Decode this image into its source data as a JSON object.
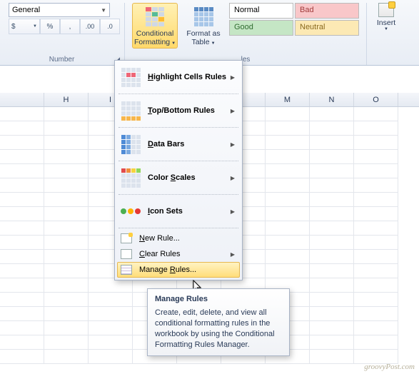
{
  "ribbon": {
    "number": {
      "format_value": "General",
      "group_label": "Number",
      "currency": "$",
      "percent": "%",
      "comma": ",",
      "inc_dec": "←0",
      "dec_dec": "0→"
    },
    "styles": {
      "cond_fmt_label": "Conditional Formatting",
      "fmt_table_label": "Format as Table",
      "normal": "Normal",
      "bad": "Bad",
      "good": "Good",
      "neutral": "Neutral",
      "group_label_fragment": "les"
    },
    "cells": {
      "insert_label": "Insert"
    }
  },
  "columns": [
    "",
    "H",
    "I",
    "",
    "",
    "",
    "M",
    "N",
    "O"
  ],
  "menu": {
    "highlight": "Highlight Cells Rules",
    "topbottom": "Top/Bottom Rules",
    "databars": "Data Bars",
    "colorscales": "Color Scales",
    "iconsets": "Icon Sets",
    "newrule": "New Rule...",
    "clearrules": "Clear Rules",
    "managerules": "Manage Rules..."
  },
  "tooltip": {
    "title": "Manage Rules",
    "body": "Create, edit, delete, and view all conditional formatting rules in the workbook by using the Conditional Formatting Rules Manager."
  },
  "watermark": "groovyPost.com"
}
